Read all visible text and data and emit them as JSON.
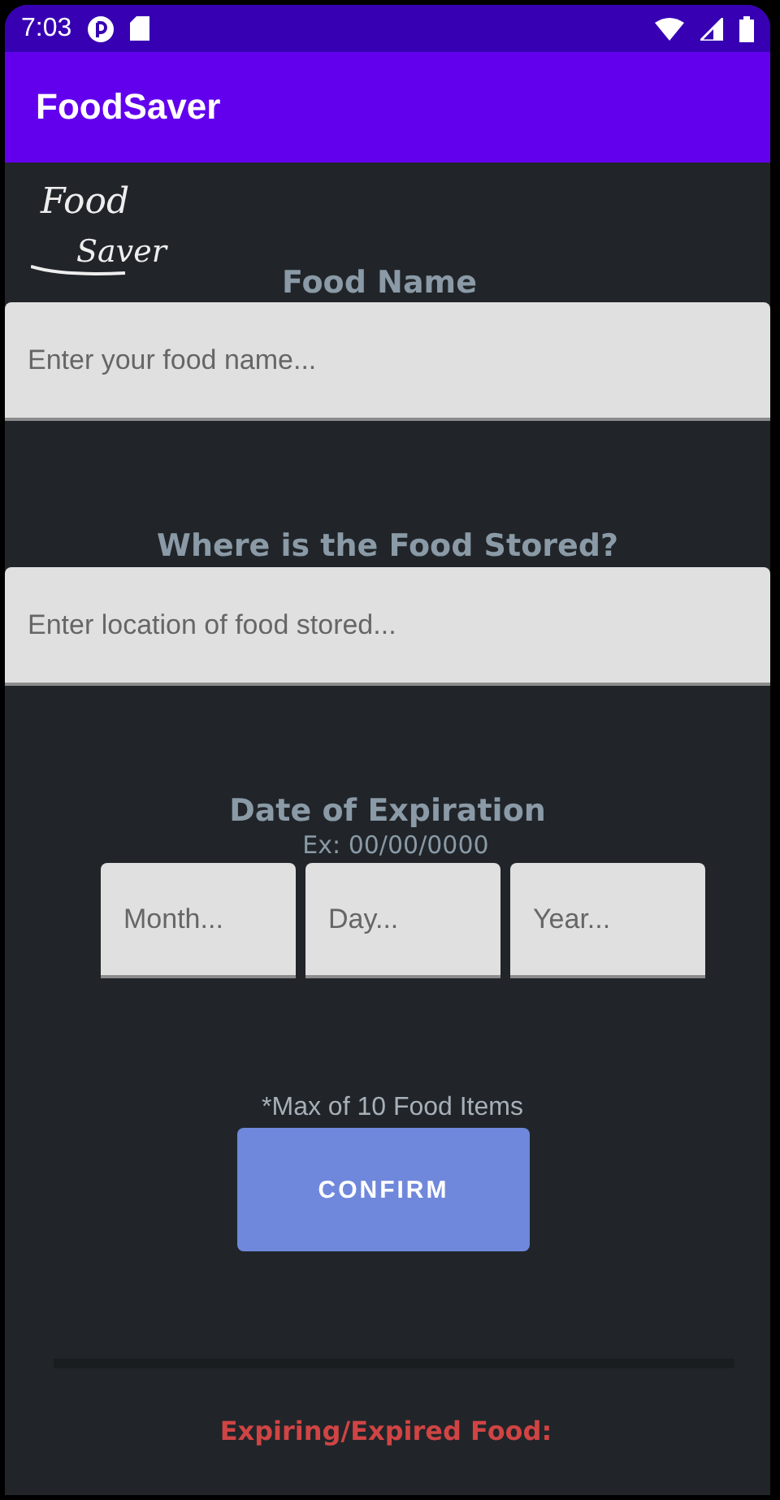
{
  "status_bar": {
    "time": "7:03"
  },
  "app_bar": {
    "title": "FoodSaver"
  },
  "logo": {
    "line_1": "Food",
    "line_2": "Saver"
  },
  "sections": [
    {
      "title": "Food Name",
      "fields": [
        {
          "placeholder": "Enter your food name..."
        }
      ]
    },
    {
      "title": "Where is the Food Stored?",
      "fields": [
        {
          "placeholder": "Enter location of food stored..."
        }
      ]
    },
    {
      "title": "Date of Expiration",
      "hint": "Ex: 00/00/0000",
      "fields": [
        {
          "placeholder": "Month..."
        },
        {
          "placeholder": "Day..."
        },
        {
          "placeholder": "Year..."
        }
      ]
    }
  ],
  "note": "*Max of 10 Food Items",
  "confirm_button": "CONFIRM",
  "expiring_heading": "Expiring/Expired Food:"
}
